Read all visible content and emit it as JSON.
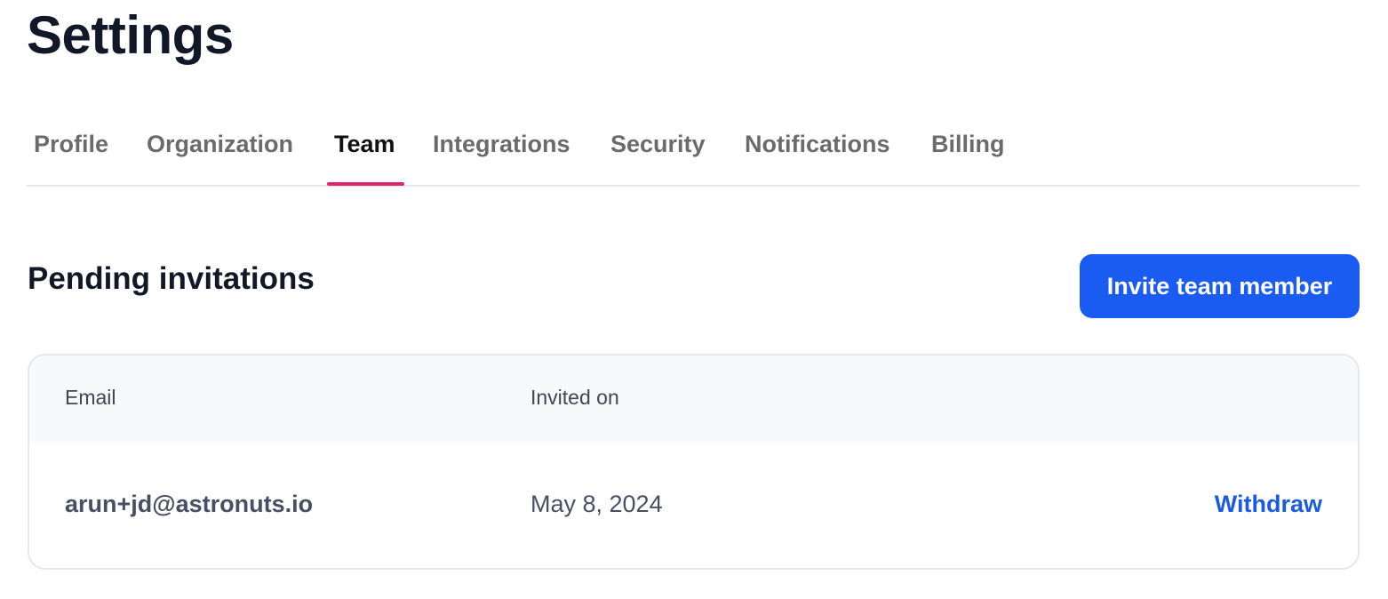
{
  "page": {
    "title": "Settings"
  },
  "tabs": [
    {
      "label": "Profile",
      "active": false
    },
    {
      "label": "Organization",
      "active": false
    },
    {
      "label": "Team",
      "active": true
    },
    {
      "label": "Integrations",
      "active": false
    },
    {
      "label": "Security",
      "active": false
    },
    {
      "label": "Notifications",
      "active": false
    },
    {
      "label": "Billing",
      "active": false
    }
  ],
  "colors": {
    "accent": "#1a5cf2",
    "active_tab_underline": "#e0256f",
    "link": "#1a5ce0"
  },
  "pending": {
    "title": "Pending invitations",
    "invite_button_label": "Invite team member",
    "columns": [
      "Email",
      "Invited on"
    ],
    "rows": [
      {
        "email": "arun+jd@astronuts.io",
        "invited_on": "May 8, 2024",
        "action": "Withdraw"
      }
    ]
  }
}
